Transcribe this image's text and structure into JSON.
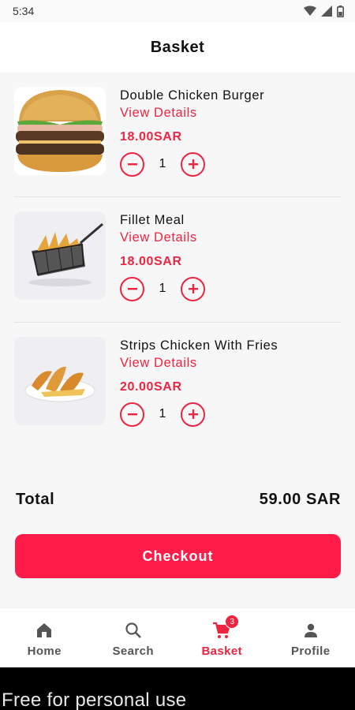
{
  "status_bar": {
    "time": "5:34",
    "icons": [
      "wifi-icon",
      "signal-icon",
      "battery-icon"
    ]
  },
  "header": {
    "title": "Basket"
  },
  "items": [
    {
      "name": "Double Chicken Burger",
      "details_label": "View Details",
      "price": "18.00SAR",
      "quantity": "1",
      "image": "burger-image"
    },
    {
      "name": "Fillet Meal",
      "details_label": "View Details",
      "price": "18.00SAR",
      "quantity": "1",
      "image": "fries-basket-image"
    },
    {
      "name": "Strips Chicken With Fries",
      "details_label": "View Details",
      "price": "20.00SAR",
      "quantity": "1",
      "image": "chicken-strips-image"
    }
  ],
  "summary": {
    "total_label": "Total",
    "total_value": "59.00 SAR"
  },
  "checkout": {
    "label": "Checkout"
  },
  "nav": {
    "items": [
      {
        "label": "Home",
        "icon": "home-icon"
      },
      {
        "label": "Search",
        "icon": "search-icon"
      },
      {
        "label": "Basket",
        "icon": "cart-icon",
        "badge": "3",
        "active": true
      },
      {
        "label": "Profile",
        "icon": "person-icon"
      }
    ]
  },
  "footer": {
    "text": "Free for personal use"
  },
  "colors": {
    "accent": "#ee2542",
    "button": "#ff1c48",
    "background": "#f7f7f7"
  }
}
